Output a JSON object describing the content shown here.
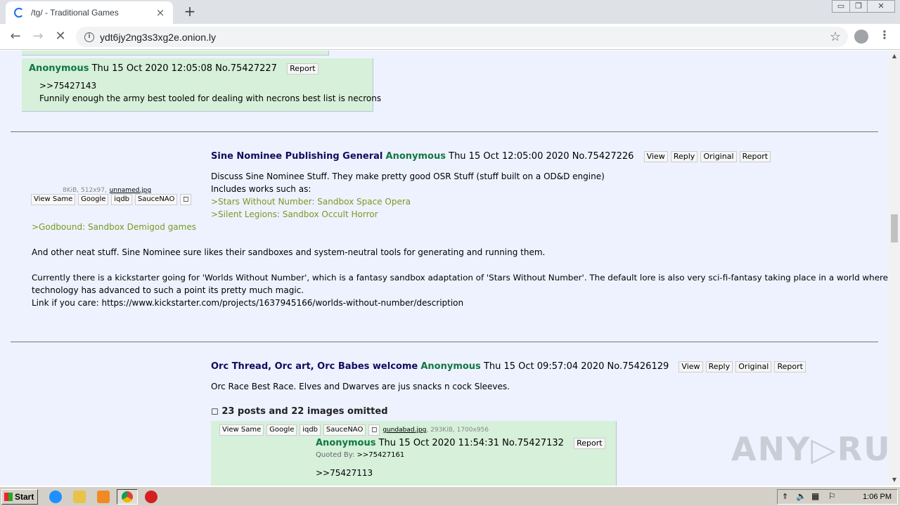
{
  "browser": {
    "tab_title": "/tg/ - Traditional Games",
    "tab_close": "×",
    "new_tab": "+",
    "url": "ydt6jy2ng3s3xg2e.onion.ly",
    "window_controls": [
      "▭",
      "❐",
      "✕"
    ]
  },
  "posts": {
    "reply1": {
      "name": "Anonymous",
      "date": "Thu 15 Oct 2020 12:05:08",
      "no": "No.75427227",
      "report": "Report",
      "quote": ">>75427143",
      "text": "Funnily enough the army best tooled for dealing with necrons best list is necrons"
    },
    "thread1": {
      "file_info": "8KiB, 512x97,",
      "file_name": "unnamed.jpg",
      "img_buttons": [
        "View Same",
        "Google",
        "iqdb",
        "SauceNAO",
        "◻"
      ],
      "subject": "Sine Nominee Publishing General",
      "name": "Anonymous",
      "date": "Thu 15 Oct 12:05:00 2020",
      "no": "No.75427226",
      "buttons": [
        "View",
        "Reply",
        "Original",
        "Report"
      ],
      "line1": "Discuss Sine Nominee Stuff. They make pretty good OSR Stuff (stuff built on a OD&D engine)",
      "line2": "Includes works such as:",
      "quote1": ">Stars Without Number: Sandbox Space Opera",
      "quote2": ">Silent Legions: Sandbox Occult Horror",
      "quote3": ">Godbound: Sandbox Demigod games",
      "para1": "And other neat stuff. Sine Nominee sure likes their sandboxes and system-neutral tools for generating and running them.",
      "para2a": "Currently there is a kickstarter going for 'Worlds Without Number', which is a fantasy sandbox adaptation of 'Stars Without Number'. The default lore is also very sci-fi-fantasy taking place in a world where",
      "para2b": "technology has advanced to such a point its pretty much magic.",
      "link_line": "Link if you care: https://www.kickstarter.com/projects/1637945166/worlds-without-number/description"
    },
    "thread2": {
      "subject": "Orc Thread, Orc art, Orc Babes welcome",
      "name": "Anonymous",
      "date": "Thu 15 Oct 09:57:04 2020",
      "no": "No.75426129",
      "buttons": [
        "View",
        "Reply",
        "Original",
        "Report"
      ],
      "text": "Orc Race Best Race. Elves and Dwarves are jus snacks n cock Sleeves.",
      "omitted": "◻ 23 posts and 22 images omitted"
    },
    "reply2": {
      "img_buttons": [
        "View Same",
        "Google",
        "iqdb",
        "SauceNAO",
        "◻"
      ],
      "file_name": "gundabad.jpg",
      "file_info": ", 293KiB, 1700x956",
      "name": "Anonymous",
      "date": "Thu 15 Oct 2020 11:54:31",
      "no": "No.75427132",
      "report": "Report",
      "quoted_by_label": "Quoted By:",
      "quoted_by": ">>75427161",
      "quote": ">>75427113"
    }
  },
  "watermark": "ANY▷RUN",
  "taskbar": {
    "start": "Start",
    "clock": "1:06 PM"
  }
}
